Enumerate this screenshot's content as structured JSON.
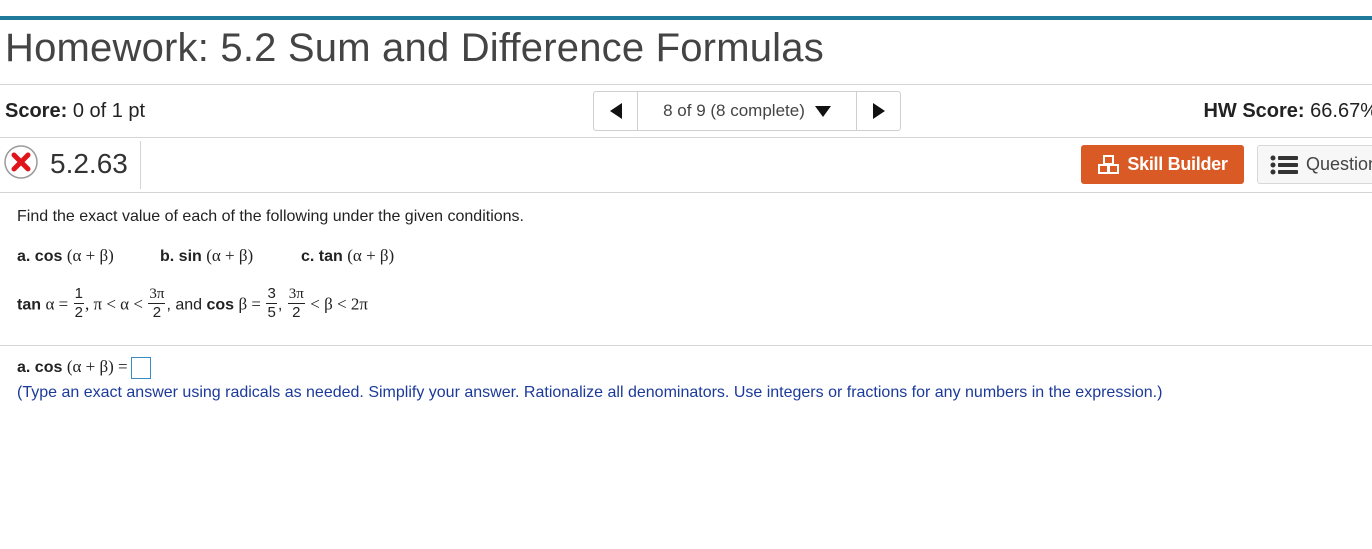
{
  "header": {
    "title": "Homework: 5.2 Sum and Difference Formulas",
    "accent_color": "#1f7a9a"
  },
  "score": {
    "label": "Score:",
    "value": "0 of 1 pt"
  },
  "nav": {
    "position_text": "8 of 9 (8 complete)"
  },
  "hw_score": {
    "label": "HW Score:",
    "value": "66.67%"
  },
  "question": {
    "status_icon": "incorrect-x-icon",
    "number": "5.2.63",
    "skill_builder_label": "Skill Builder",
    "skill_builder_color": "#d95a24",
    "question_list_label": "Question"
  },
  "problem": {
    "instruction": "Find the exact value of each of the following under the given conditions.",
    "parts": [
      {
        "label": "a. cos",
        "expr": "(α + β)"
      },
      {
        "label": "b. sin",
        "expr": "(α + β)"
      },
      {
        "label": "c. tan",
        "expr": "(α + β)"
      }
    ],
    "condition": {
      "tan_label": "tan",
      "alpha_eq": "α =",
      "tan_num": "1",
      "tan_den": "2",
      "alpha_range_left": ", π < α <",
      "alpha_upper_num": "3π",
      "alpha_upper_den": "2",
      "and_text": ", and",
      "cos_label": "cos",
      "beta_eq": "β =",
      "cos_num": "3",
      "cos_den": "5",
      "beta_lower_num": "3π",
      "beta_lower_den": "2",
      "beta_range_right": "< β < 2π"
    }
  },
  "answer": {
    "label": "a. cos",
    "expr": "(α + β) =",
    "hint": "(Type an exact answer using radicals as needed. Simplify your answer. Rationalize all denominators. Use integers or fractions for any numbers in the expression.)"
  }
}
